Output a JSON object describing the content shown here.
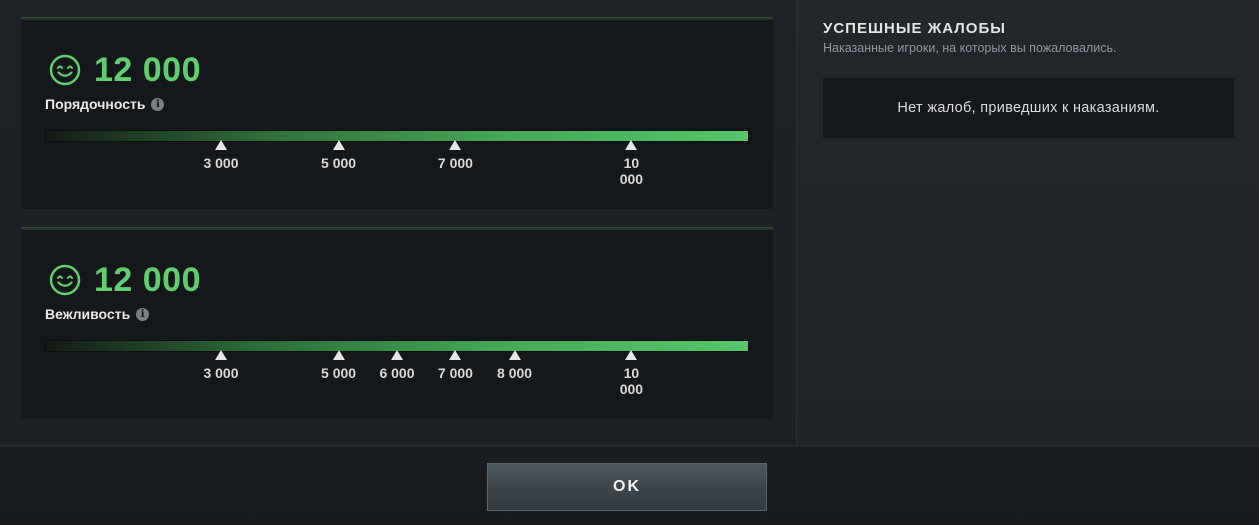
{
  "behavior": {
    "score": "12 000",
    "label": "Порядочность",
    "fill_fraction": 1.0,
    "ticks": [
      {
        "label": "3 000",
        "position": 0.25
      },
      {
        "label": "5 000",
        "position": 0.417
      },
      {
        "label": "7 000",
        "position": 0.583
      },
      {
        "label": "10 000",
        "position": 0.833
      }
    ]
  },
  "communication": {
    "score": "12 000",
    "label": "Вежливость",
    "fill_fraction": 1.0,
    "ticks": [
      {
        "label": "3 000",
        "position": 0.25
      },
      {
        "label": "5 000",
        "position": 0.417
      },
      {
        "label": "6 000",
        "position": 0.5
      },
      {
        "label": "7 000",
        "position": 0.583
      },
      {
        "label": "8 000",
        "position": 0.667
      },
      {
        "label": "10 000",
        "position": 0.833
      }
    ]
  },
  "reports_panel": {
    "title": "УСПЕШНЫЕ ЖАЛОБЫ",
    "subtitle": "Наказанные игроки, на которых вы пожаловались.",
    "empty_text": "Нет жалоб, приведших к наказаниям."
  },
  "footer": {
    "ok_label": "OK"
  },
  "colors": {
    "score_green": "#5fcf6e",
    "bar_green": "#56c66a",
    "panel_dark": "#15181b"
  },
  "icons": {
    "score": "smiley-icon",
    "info": "info-icon"
  }
}
